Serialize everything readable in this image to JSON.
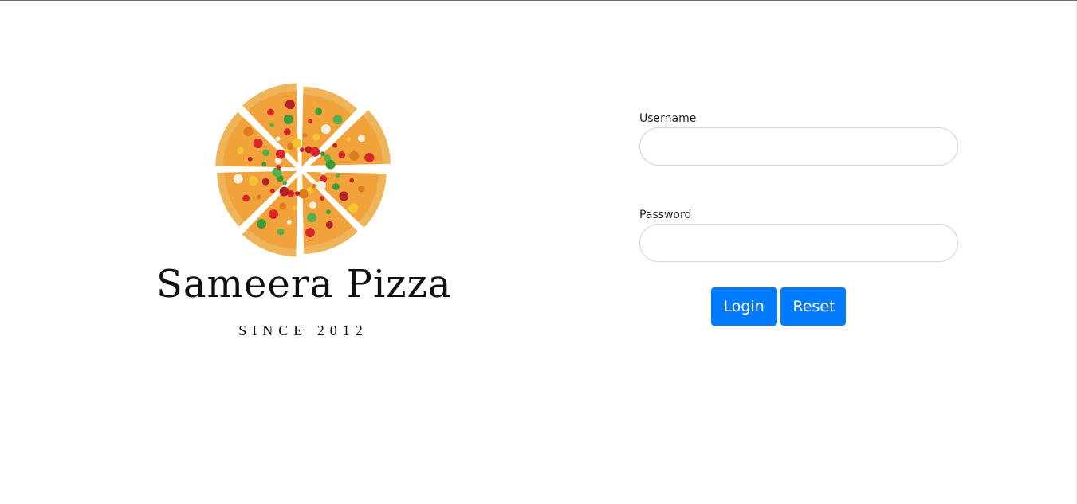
{
  "brand": {
    "name": "Sameera Pizza",
    "tagline": "SINCE 2012",
    "logo_icon": "pizza-logo-icon"
  },
  "form": {
    "username_label": "Username",
    "username_value": "",
    "password_label": "Password",
    "password_value": "",
    "login_label": "Login",
    "reset_label": "Reset"
  },
  "colors": {
    "button": "#007bff",
    "input_border": "#ced4da",
    "text": "#212529"
  }
}
